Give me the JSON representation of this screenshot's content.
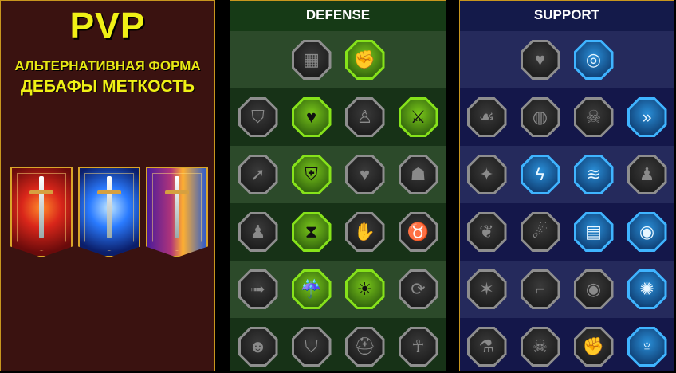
{
  "pvp": {
    "title": "PVP",
    "subtitle1": "АЛЬТЕРНАТИВНАЯ ФОРМА",
    "subtitle2": "ДЕБАФЫ МЕТКОСТЬ",
    "banners": [
      "red-knight-banner",
      "blue-knight-banner",
      "crossed-swords-banner"
    ]
  },
  "defense": {
    "title": "DEFENSE",
    "rows": [
      [
        {
          "icon": "wall-icon",
          "style": "gray"
        },
        {
          "icon": "fist-icon",
          "style": "green"
        }
      ],
      [
        {
          "icon": "chevron-shield-icon",
          "style": "gray"
        },
        {
          "icon": "heart-hand-icon",
          "style": "green"
        },
        {
          "icon": "strongman-icon",
          "style": "gray"
        },
        {
          "icon": "swords-icon",
          "style": "green"
        }
      ],
      [
        {
          "icon": "runner-icon",
          "style": "gray"
        },
        {
          "icon": "knight-shield-icon",
          "style": "green"
        },
        {
          "icon": "heart-icon",
          "style": "gray"
        },
        {
          "icon": "hooded-figure-icon",
          "style": "gray"
        }
      ],
      [
        {
          "icon": "warriors-icon",
          "style": "gray"
        },
        {
          "icon": "hourglass-icon",
          "style": "green"
        },
        {
          "icon": "hand-icon",
          "style": "gray"
        },
        {
          "icon": "bull-icon",
          "style": "gray"
        }
      ],
      [
        {
          "icon": "dash-icon",
          "style": "gray"
        },
        {
          "icon": "drops-icon",
          "style": "green"
        },
        {
          "icon": "skull-sun-icon",
          "style": "green"
        },
        {
          "icon": "swirl-icon",
          "style": "gray"
        }
      ],
      [
        {
          "icon": "ogre-icon",
          "style": "gray"
        },
        {
          "icon": "winged-shield-icon",
          "style": "gray"
        },
        {
          "icon": "helmet-icon",
          "style": "gray"
        },
        {
          "icon": "muscle-icon",
          "style": "gray"
        }
      ]
    ]
  },
  "support": {
    "title": "SUPPORT",
    "rows": [
      [
        {
          "icon": "heart-plus-icon",
          "style": "gray"
        },
        {
          "icon": "target-hand-icon",
          "style": "blue"
        }
      ],
      [
        {
          "icon": "praying-hands-icon",
          "style": "gray"
        },
        {
          "icon": "shield-aura-icon",
          "style": "gray"
        },
        {
          "icon": "skull-smoke-icon",
          "style": "gray"
        },
        {
          "icon": "speed-boots-icon",
          "style": "blue"
        }
      ],
      [
        {
          "icon": "sparkle-figure-icon",
          "style": "gray"
        },
        {
          "icon": "lightning-shield-icon",
          "style": "blue"
        },
        {
          "icon": "cracked-ground-icon",
          "style": "blue"
        },
        {
          "icon": "shadow-figure-icon",
          "style": "gray"
        }
      ],
      [
        {
          "icon": "heart-chain-icon",
          "style": "gray"
        },
        {
          "icon": "comet-icon",
          "style": "gray"
        },
        {
          "icon": "book-icon",
          "style": "blue"
        },
        {
          "icon": "angry-eyes-icon",
          "style": "blue"
        }
      ],
      [
        {
          "icon": "compass-star-icon",
          "style": "gray"
        },
        {
          "icon": "boot-icon",
          "style": "gray"
        },
        {
          "icon": "eye-icon",
          "style": "gray"
        },
        {
          "icon": "kick-icon",
          "style": "blue"
        }
      ],
      [
        {
          "icon": "poison-flask-icon",
          "style": "gray"
        },
        {
          "icon": "skull-icon",
          "style": "gray"
        },
        {
          "icon": "fist-bandage-icon",
          "style": "gray"
        },
        {
          "icon": "eagle-icon",
          "style": "blue"
        }
      ]
    ]
  }
}
